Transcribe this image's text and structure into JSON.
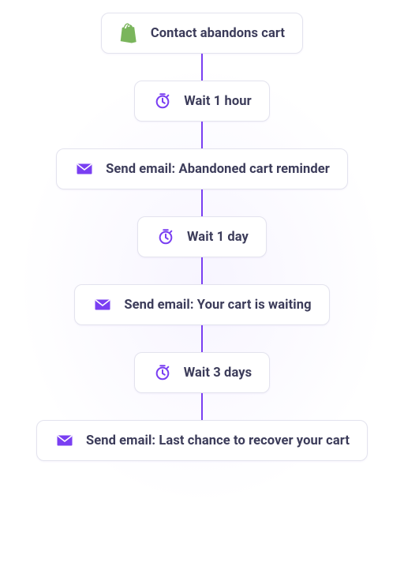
{
  "workflow": {
    "steps": [
      {
        "icon": "shopify-icon",
        "label": "Contact abandons cart"
      },
      {
        "icon": "timer-icon",
        "label": "Wait 1 hour"
      },
      {
        "icon": "email-icon",
        "label": "Send email: Abandoned cart reminder"
      },
      {
        "icon": "timer-icon",
        "label": "Wait 1 day"
      },
      {
        "icon": "email-icon",
        "label": "Send email: Your cart is waiting"
      },
      {
        "icon": "timer-icon",
        "label": "Wait 3 days"
      },
      {
        "icon": "email-icon",
        "label": "Send email: Last chance to recover your cart"
      }
    ]
  },
  "colors": {
    "accent": "#7a3ff2",
    "shopify": "#7ab55c",
    "border": "#e3e3ee",
    "text": "#3c3c5a"
  }
}
